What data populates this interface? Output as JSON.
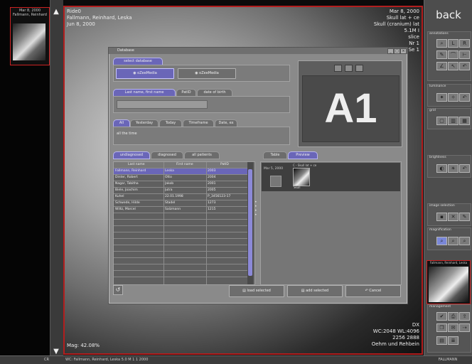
{
  "left_strip": {
    "thumb_caption": [
      "Mar 8, 2000",
      "Fallmann, Reinhard"
    ]
  },
  "viewer": {
    "top_left": [
      "Ride0",
      "Fallmann, Reinhard, Leska",
      "Jun 8, 2000"
    ],
    "top_right": [
      "Mar 8, 2000",
      "Skull lat + ce",
      "Skull (cranium) lat",
      "5.1M I",
      "slice",
      "Nr 1",
      "Se 1"
    ],
    "bottom_right": [
      "DX",
      "WC:2048 WL:4096",
      "2256 2888",
      "Oehm und Rehbein"
    ],
    "bottom_left": "Mag: 42.08%"
  },
  "dialog": {
    "title": "Database",
    "select_db_tab": "select database",
    "db_buttons": [
      "oZeeMedia",
      "oZeeMedia"
    ],
    "name_tabs": [
      "Last name, first name",
      "PatID",
      "date of birth"
    ],
    "time_tabs": [
      "All",
      "Yesterday",
      "Today",
      "Timeframe",
      "Date, ex"
    ],
    "time_value": "all the time",
    "list_tabs": [
      "undiagnosed",
      "diagnosed",
      "all patients"
    ],
    "table": {
      "headers": [
        "Last name",
        "First name",
        "PatID"
      ],
      "rows": [
        [
          "Fallmann, Reinhard",
          "Leska",
          "2003"
        ],
        [
          "Dinter, Robert",
          "Otto",
          "2004"
        ],
        [
          "Nagar, Tabitha",
          "Jakob",
          "2001"
        ],
        [
          "Biele, Joachim",
          "Jutra",
          "2005"
        ],
        [
          "Kuhel",
          "22.01.1998",
          "P_3456123-17"
        ],
        [
          "Schwede, Hilde",
          "Stadel",
          "1273"
        ],
        [
          "Wiltz, Marcel",
          "Salzmann",
          "1215"
        ]
      ]
    },
    "preview_tabs": [
      "Table",
      "Preview"
    ],
    "preview": {
      "date": "Mar 5, 2000",
      "series_label": "C - Skull lat + ce",
      "thumb_label": "Skull"
    },
    "a1_label": "A1",
    "footer_buttons": [
      "load selected",
      "add selected",
      "Cancel"
    ]
  },
  "right_panel": {
    "back": "back",
    "groups": [
      "annotations",
      "luminance",
      "grid",
      "brightness",
      "image selection",
      "magnification"
    ],
    "thumb_caption": "Fallmann, Reinhard, Leska",
    "bottom_group": "management",
    "bottom_caption": "FALLMANN"
  },
  "status": {
    "left": "CR",
    "center": "WC: Fallmann, Reinhard, Leska 5.0 M 1 1 2000",
    "right": ""
  }
}
